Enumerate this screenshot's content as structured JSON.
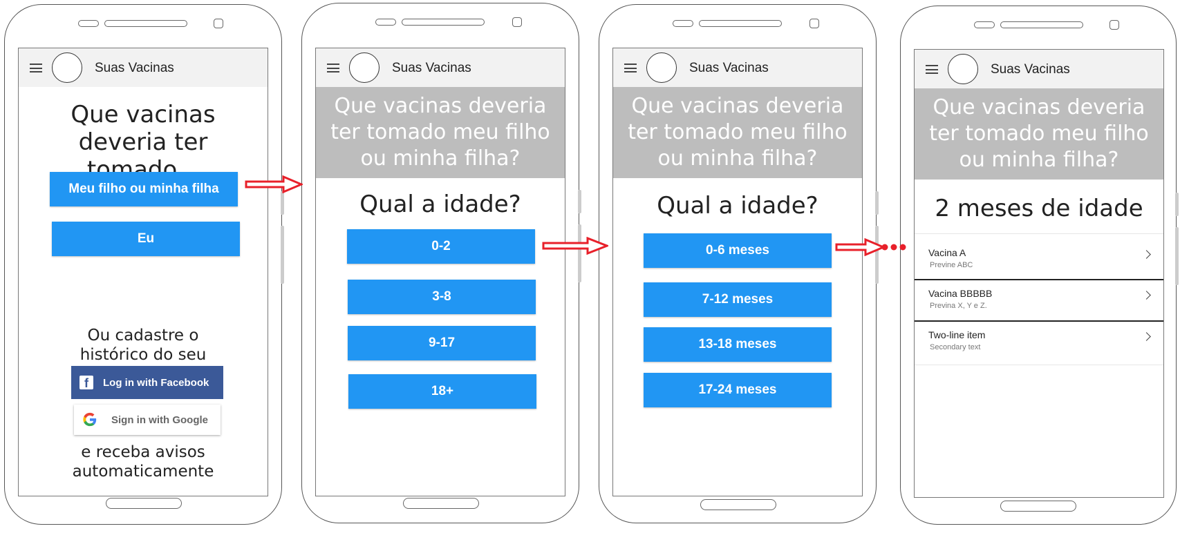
{
  "app": {
    "title": "Suas Vacinas"
  },
  "colors": {
    "primary_button": "#2196f3",
    "facebook": "#3b5998",
    "banner": "#bdbdbd",
    "arrow": "#e8202a"
  },
  "screen1": {
    "question": "Que vacinas deveria ter tomado...",
    "buttons": [
      "Meu filho ou minha filha",
      "Eu"
    ],
    "register_text": "Ou cadastre o histórico do seu filho (ou seu)",
    "facebook_label": "Log in with Facebook",
    "google_label": "Sign in with Google",
    "footer_text": "e receba avisos automaticamente"
  },
  "screen2": {
    "banner": "Que vacinas deveria ter tomado meu filho ou minha filha?",
    "question": "Qual a idade?",
    "buttons": [
      "0-2",
      "3-8",
      "9-17",
      "18+"
    ]
  },
  "screen3": {
    "banner": "Que vacinas deveria ter tomado meu filho ou minha filha?",
    "question": "Qual a idade?",
    "buttons": [
      "0-6 meses",
      "7-12 meses",
      "13-18 meses",
      "17-24 meses"
    ]
  },
  "screen4": {
    "banner": "Que vacinas deveria ter tomado meu filho ou minha filha?",
    "heading": "2 meses de idade",
    "items": [
      {
        "primary": "Vacina A",
        "secondary": "Previne ABC"
      },
      {
        "primary": "Vacina BBBBB",
        "secondary": "Previna X, Y e Z."
      },
      {
        "primary": "Two-line item",
        "secondary": "Secondary text"
      }
    ]
  }
}
